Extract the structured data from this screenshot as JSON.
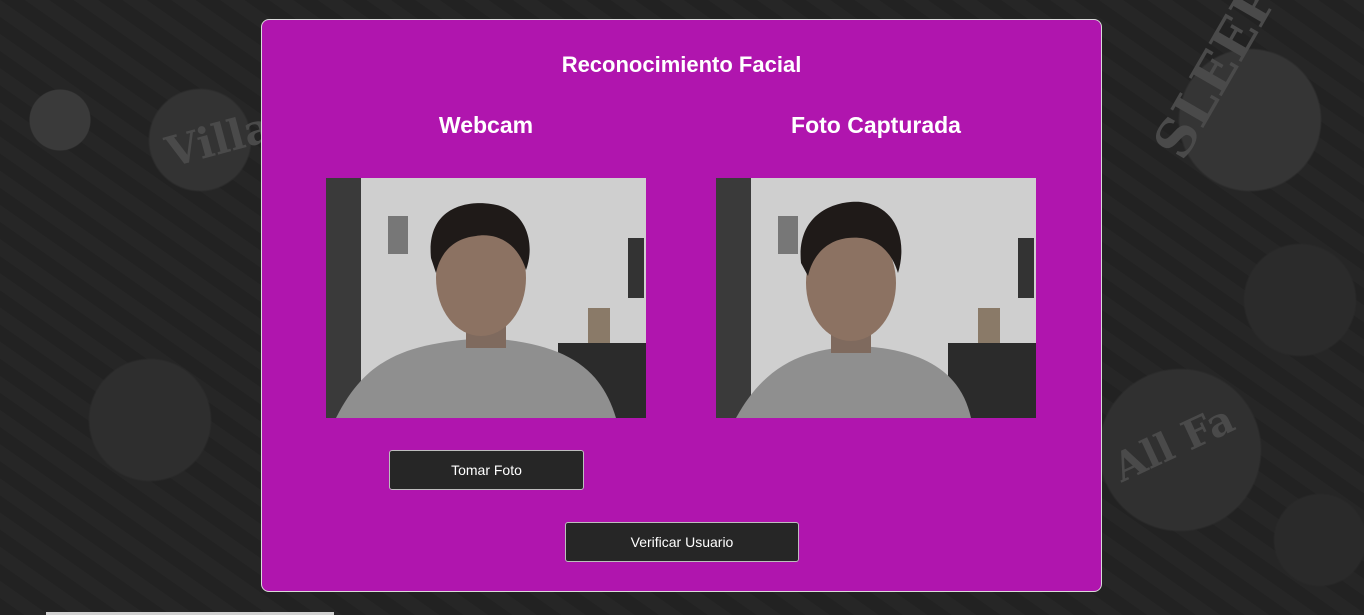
{
  "page": {
    "title": "Reconocimiento Facial"
  },
  "webcam": {
    "heading": "Webcam",
    "button_label": "Tomar Foto"
  },
  "captured": {
    "heading": "Foto Capturada"
  },
  "verify": {
    "button_label": "Verificar Usuario"
  },
  "colors": {
    "panel": "#b015ae",
    "button": "#262626",
    "text": "#ffffff"
  }
}
